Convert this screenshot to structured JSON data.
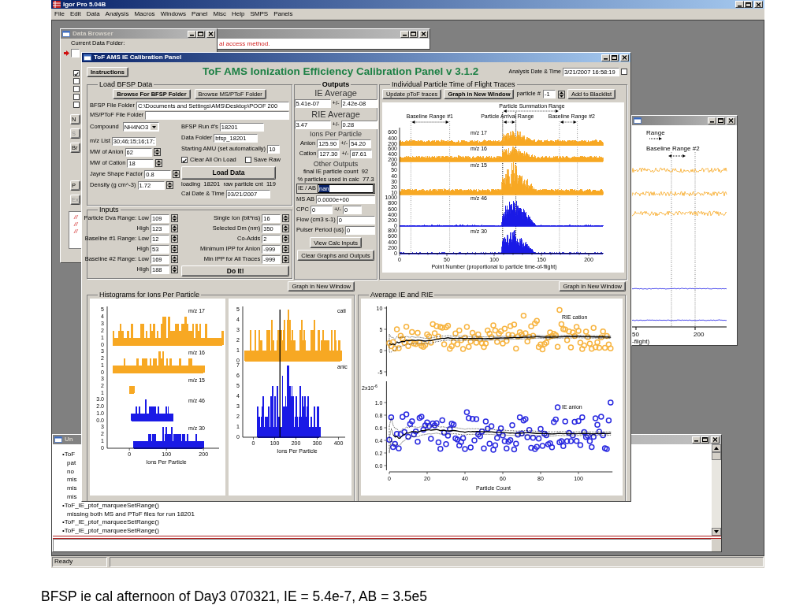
{
  "app": {
    "title": "Igor Pro 5.04B",
    "menus": [
      "File",
      "Edit",
      "Data",
      "Analysis",
      "Macros",
      "Windows",
      "Panel",
      "Misc",
      "Help",
      "SMPS",
      "Panels"
    ],
    "status": "Ready"
  },
  "data_browser": {
    "title": "Data Browser",
    "label": "Current Data Folder:",
    "checkboxes": [
      {
        "checked": true
      },
      {
        "checked": false
      },
      {
        "checked": false
      },
      {
        "checked": false
      },
      {
        "checked": false
      }
    ],
    "buttons": [
      {
        "label": "N",
        "disabled": false
      },
      {
        "label": "S",
        "disabled": true
      },
      {
        "label": "Br",
        "disabled": false
      },
      {
        "label": "P",
        "disabled": false
      },
      {
        "label": "Ex",
        "disabled": true
      }
    ],
    "list": [
      "//",
      "//",
      "//"
    ]
  },
  "notice": {
    "text": "al access method."
  },
  "side_graph": {
    "labels": [
      "Range",
      "Baseline Range #2"
    ],
    "xticks": [
      "50",
      "200"
    ],
    "xlabel": "-flight)"
  },
  "command_window": {
    "title": "Un",
    "history": [
      "•ToF",
      "pat",
      "no",
      "mis",
      "mis",
      "mis",
      "•ToF_IE_ptof_marqueeSetRange()",
      "missing both MS and PToF files for run 18201",
      "•ToF_IE_ptof_marqueeSetRange()",
      "•ToF_IE_ptof_marqueeSetRange()"
    ]
  },
  "panel": {
    "title": "ToF AMS IE Calibration Panel",
    "instructions": "Instructions",
    "heading": "ToF AMS Ionization Efficiency Calibration Panel v 3.1.2",
    "analysis": {
      "label": "Analysis Date & Time",
      "value": "3/21/2007 16:58:19",
      "checked": false
    },
    "load": {
      "title": "Load BFSP Data",
      "buttons": [
        {
          "label": "Browse For BFSP Folder",
          "bold": true
        },
        {
          "label": "Browse MS/PToF Folder",
          "bold": false
        }
      ],
      "folders": [
        {
          "label": "BFSP File Folder",
          "value": "C:\\Documents and Settings\\AMS\\Desktop\\POOF 200"
        },
        {
          "label": "MS/PToF File Folder"
        }
      ],
      "left_fields": [
        {
          "kind": "popup",
          "label": "Compound",
          "value": "NH4NO3"
        },
        {
          "kind": "text",
          "label": "m/z List",
          "value": "30;46;15;16;17;"
        },
        {
          "kind": "spin",
          "label": "MW of Anion",
          "value": "62"
        },
        {
          "kind": "spin",
          "label": "MW of Cation",
          "value": "18"
        },
        {
          "kind": "spin",
          "label": "Jayne Shape Factor",
          "value": "0.8"
        },
        {
          "kind": "spin",
          "label": "Density (g cm^-3)",
          "value": "1.72"
        }
      ],
      "right_fields": [
        {
          "label": "BFSP Run #'s",
          "value": "18201"
        },
        {
          "label": "Data Folder",
          "value": "bfsp_18201"
        },
        {
          "label": "Starting AMU (set automatically)",
          "value": "10"
        }
      ],
      "checkboxes": [
        {
          "label": "Clear All On Load",
          "checked": true
        },
        {
          "label": "Save Raw",
          "checked": false
        }
      ],
      "load_button": "Load Data",
      "status": "loading  18201  raw particle cnt  119",
      "cal_date": {
        "label": "Cal Date & Time",
        "value": "03/21/2007"
      }
    },
    "inputs": {
      "title": "Inputs",
      "ranges": [
        {
          "label": "Particle Dva Range: Low",
          "value": "109",
          "high_label": "High",
          "high_value": "123"
        },
        {
          "label": "Baseline #1 Range: Low",
          "value": "12",
          "high_label": "High",
          "high_value": "53"
        },
        {
          "label": "Baseline #2 Range: Low",
          "value": "169",
          "high_label": "High",
          "high_value": "188"
        }
      ],
      "settings": [
        {
          "label": "Single Ion (bit*ns)",
          "value": "16"
        },
        {
          "label": "Selected Dm (nm)",
          "value": "350"
        },
        {
          "label": "Co-Adds",
          "value": "2"
        },
        {
          "label": "Minimum IPP for Anion",
          "value": "-999"
        },
        {
          "label": "Min IPP for All Traces",
          "value": "-999"
        }
      ],
      "do_button": "Do It!"
    },
    "outputs": {
      "title": "Outputs",
      "averages": [
        {
          "heading": "IE Average",
          "value": "5.41e-07",
          "pm": "+/-",
          "err": "2.42e-08"
        },
        {
          "heading": "RIE Average",
          "value": "3.47",
          "pm": "+/-",
          "err": "0.28"
        }
      ],
      "ipp_heading": "Ions Per Particle",
      "ipp": [
        {
          "label": "Anion",
          "value": "125.90",
          "pm": "+/-",
          "err": "54.20"
        },
        {
          "label": "Cation",
          "value": "127.30",
          "pm": "+/-",
          "err": "87.61"
        }
      ],
      "other_heading": "Other Outputs",
      "stats": [
        "final IE particle count  92",
        "% particles used in calc  77.3"
      ],
      "ie_ab": {
        "label": "IE / AB",
        "value": "nan",
        "highlighted": true
      },
      "fields": [
        {
          "label": "MS AB",
          "value": "0.0000e+00"
        },
        {
          "label": "CPC",
          "value": "0",
          "pm": "+/-",
          "err": "0"
        },
        {
          "label": "Flow (cm3 s-1)",
          "value": "0"
        },
        {
          "label": "Pulser Period (us)",
          "value": "0"
        }
      ],
      "buttons": [
        "View Calc Inputs",
        "Clear Graphs and Outputs"
      ]
    },
    "traces": {
      "title": "Individual Particle Time of Flight Traces",
      "buttons": [
        {
          "label": "Update pToF traces",
          "bold": false
        },
        {
          "label": "Graph in New Window",
          "bold": true
        }
      ],
      "particle_label": "particle #",
      "particle_value": "-1",
      "blacklist": "Add to Blacklist",
      "annotations": [
        "Particle Summation Range",
        "Baseline Range #1",
        "Particle Arrival Range",
        "Baseline Range #2"
      ],
      "series": [
        {
          "label": "m/z 17",
          "color": "#f7a823",
          "yticks": [
            "600",
            "400",
            "200"
          ]
        },
        {
          "label": "m/z 16",
          "color": "#f7a823",
          "yticks": [
            "600",
            "400",
            "200"
          ]
        },
        {
          "label": "m/z 15",
          "color": "#f7a823",
          "yticks": [
            "60",
            "50",
            "40",
            "30",
            "20",
            "10"
          ]
        },
        {
          "label": "m/z 46",
          "color": "#1a1ae6",
          "yticks": [
            "1000",
            "800",
            "600",
            "400",
            "200",
            "0"
          ]
        },
        {
          "label": "m/z 30",
          "color": "#1a1ae6",
          "yticks": [
            "800",
            "600",
            "400",
            "200",
            "0"
          ]
        }
      ],
      "xticks": [
        "0",
        "50",
        "100",
        "150",
        "200"
      ],
      "xlabel": "Point Number (proportional to particle time-of-flight)"
    },
    "histograms": {
      "title": "Histograms for Ions Per Particle",
      "button": "Graph in New Window",
      "left": {
        "series": [
          {
            "label": "m/z 17",
            "color": "#f7a823",
            "yticks": [
              "5",
              "4",
              "3",
              "2",
              "1",
              "0"
            ]
          },
          {
            "label": "m/z 16",
            "color": "#f7a823",
            "yticks": [
              "3",
              "2",
              "1",
              "0"
            ]
          },
          {
            "label": "m/z 15",
            "color": "#f7a823",
            "yticks": [
              "3",
              "2",
              "1"
            ]
          },
          {
            "label": "m/z 46",
            "color": "#1a1ae6",
            "yticks": [
              "3.0",
              "2.0",
              "1.0",
              "0.0"
            ]
          },
          {
            "label": "m/z 30",
            "color": "#1a1ae6",
            "yticks": [
              "3",
              "2",
              "1",
              "0"
            ]
          }
        ],
        "xticks": [
          "0",
          "100",
          "200"
        ],
        "xlabel": "Ions Per Particle"
      },
      "right": {
        "series": [
          {
            "label": "cati",
            "color": "#f7a823",
            "yticks": [
              "5",
              "4",
              "3",
              "2",
              "1",
              "0"
            ]
          },
          {
            "label": "anic",
            "color": "#1a1ae6",
            "yticks": [
              "7",
              "6",
              "5",
              "4",
              "3",
              "2",
              "1",
              "0"
            ]
          }
        ],
        "xticks": [
          "0",
          "100",
          "200",
          "300",
          "400"
        ],
        "xlabel": "Ions Per Particle"
      }
    },
    "average": {
      "title": "Average IE and RIE",
      "button": "Graph in New Window",
      "series": [
        {
          "label": "RIE cation",
          "color": "#f7b440",
          "yticks": [
            "10",
            "5",
            "0",
            "-5"
          ]
        },
        {
          "label": "IE anion",
          "color": "#2a2ae0",
          "scale": "2x10$^{-6}$",
          "yticks": [
            "1.0",
            "0.8",
            "0.6",
            "0.4",
            "0.2",
            "0.0"
          ]
        }
      ],
      "xticks": [
        "0",
        "20",
        "40",
        "60",
        "80",
        "100"
      ],
      "xlabel": "Particle Count"
    }
  },
  "caption": "BFSP ie cal afternoon of Day3 070321, IE = 5.4e-7, AB = 3.5e5"
}
